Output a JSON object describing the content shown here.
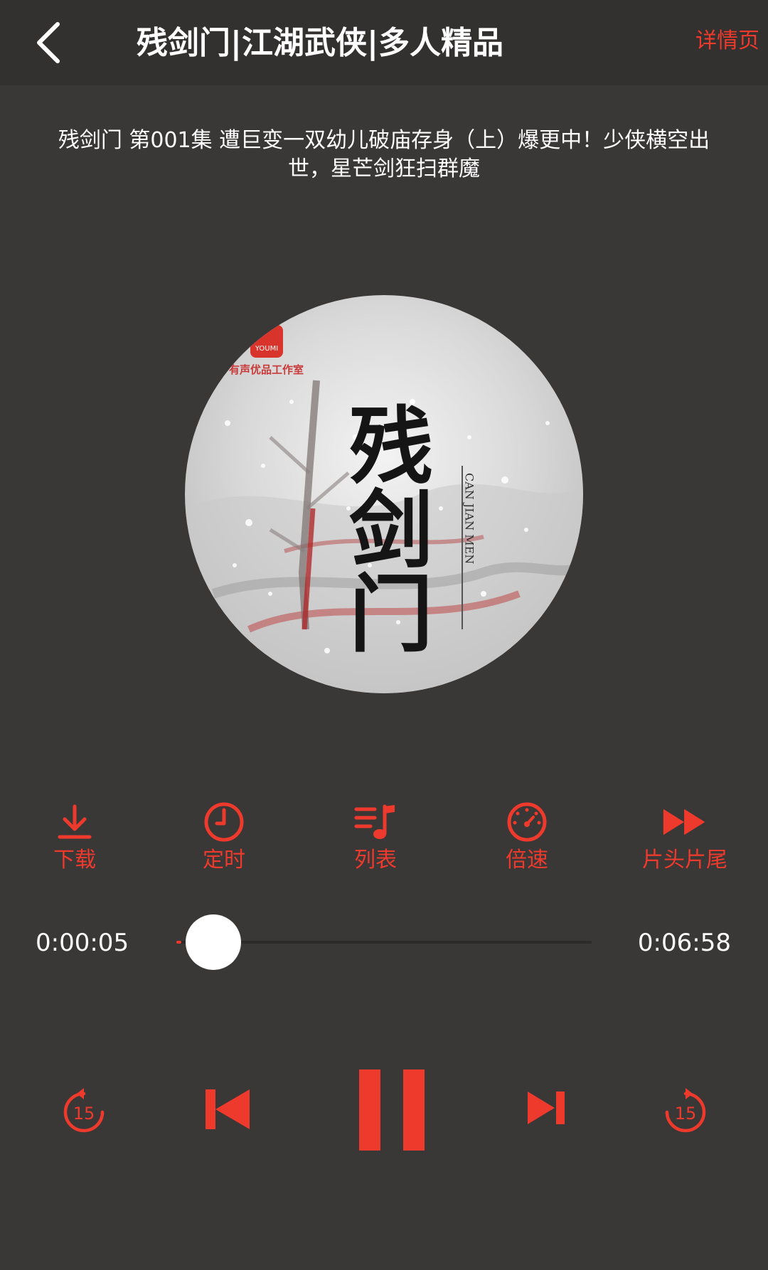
{
  "header": {
    "title": "残剑门|江湖武侠|多人精品",
    "detail_label": "详情页"
  },
  "episode": {
    "title": "残剑门 第001集 遭巨变一双幼儿破庙存身（上）爆更中！少侠横空出世，星芒剑狂扫群魔"
  },
  "cover": {
    "title_text": "残剑门",
    "romanization": "CAN JIAN MEN",
    "studio_badge": "YOUMI",
    "studio_text": "有声优品工作室"
  },
  "actions": [
    {
      "label": "下载",
      "icon": "download-icon"
    },
    {
      "label": "定时",
      "icon": "clock-icon"
    },
    {
      "label": "列表",
      "icon": "playlist-icon"
    },
    {
      "label": "倍速",
      "icon": "speed-icon"
    },
    {
      "label": "片头片尾",
      "icon": "fast-forward-icon"
    }
  ],
  "progress": {
    "current": "0:00:05",
    "duration": "0:06:58",
    "fraction": 0.012
  },
  "controls": {
    "rewind_seconds": "15",
    "forward_seconds": "15"
  },
  "colors": {
    "accent": "#ee3a2c",
    "background": "#3a3737",
    "topbar": "#333030"
  }
}
